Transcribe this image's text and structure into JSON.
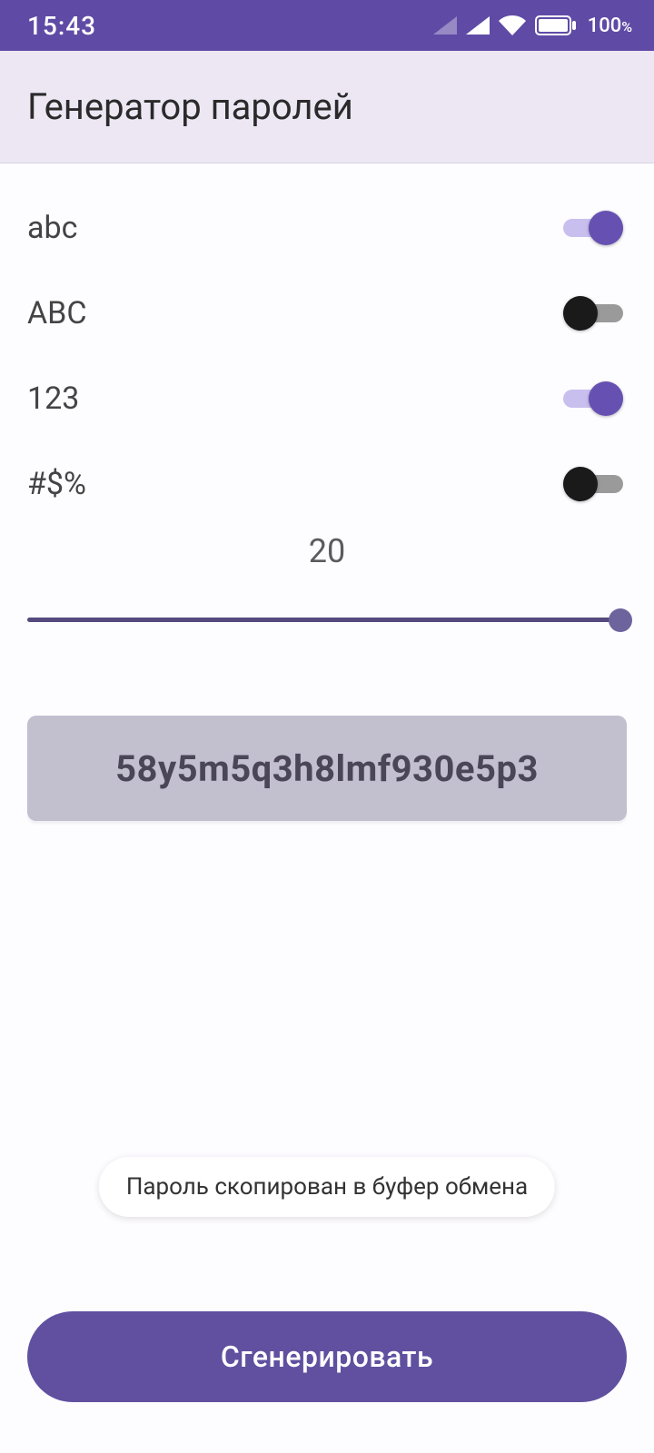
{
  "status": {
    "time": "15:43",
    "battery": "100"
  },
  "header": {
    "title": "Генератор паролей"
  },
  "options": {
    "lowercase": {
      "label": "abc",
      "on": true
    },
    "uppercase": {
      "label": "ABC",
      "on": false
    },
    "digits": {
      "label": "123",
      "on": true
    },
    "symbols": {
      "label": "#$%",
      "on": false
    }
  },
  "length": {
    "value": "20"
  },
  "password": {
    "value": "58y5m5q3h8lmf930e5p3"
  },
  "toast": {
    "text": "Пароль скопирован в буфер обмена"
  },
  "actions": {
    "generate": "Сгенерировать"
  }
}
